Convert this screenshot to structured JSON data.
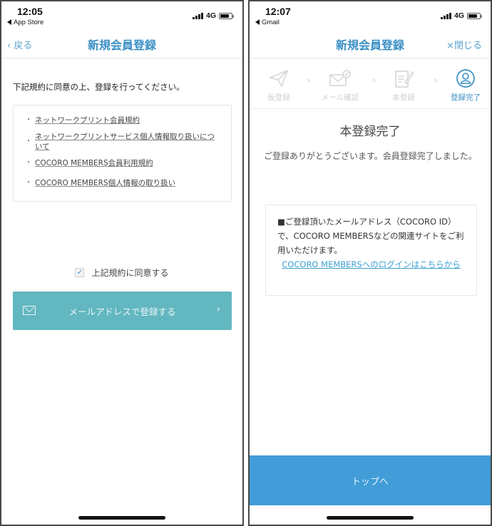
{
  "left_screen": {
    "status_bar": {
      "time": "12:05",
      "back_app": "App Store",
      "network": "4G",
      "battery_level": 0.8
    },
    "nav": {
      "back_label": "戻る",
      "title": "新規会員登録"
    },
    "lead_text": "下記規約に同意の上、登録を行ってください。",
    "terms": [
      {
        "label": "ネットワークプリント会員規約"
      },
      {
        "label": "ネットワークプリントサービス個人情報取り扱いについて"
      },
      {
        "label": "COCORO MEMBERS会員利用規約"
      },
      {
        "label": "COCORO MEMBERS個人情報の取り扱い"
      }
    ],
    "agree": {
      "label": "上記規約に同意する",
      "checked": true
    },
    "register_button": {
      "label": "メールアドレスで登録する",
      "icon": "envelope-icon",
      "chevron": "›"
    },
    "colors": {
      "accent": "#3a8fc4",
      "button": "#62b7c0"
    }
  },
  "right_screen": {
    "status_bar": {
      "time": "12:07",
      "back_app": "Gmail",
      "network": "4G",
      "battery_level": 0.8
    },
    "nav": {
      "title": "新規会員登録",
      "close_label": "×閉じる"
    },
    "steps": [
      {
        "label": "仮登録",
        "icon": "paper-plane-icon",
        "active": false
      },
      {
        "label": "メール確認",
        "icon": "mail-check-icon",
        "active": false
      },
      {
        "label": "本登録",
        "icon": "document-edit-icon",
        "active": false
      },
      {
        "label": "登録完了",
        "icon": "user-circle-icon",
        "active": true
      }
    ],
    "step_separator": "›",
    "title": "本登録完了",
    "message": "ご登録ありがとうございます。会員登録完了しました。",
    "info": {
      "text": "■ご登録頂いたメールアドレス（COCORO ID）で、COCORO MEMBERSなどの関連サイトをご利用いただけます。",
      "link": "COCORO MEMBERSへのログインはこちらから"
    },
    "top_button": {
      "label": "トップへ"
    },
    "colors": {
      "accent": "#3a8fc4",
      "button": "#419cd8",
      "link": "#3a9fd0"
    }
  }
}
